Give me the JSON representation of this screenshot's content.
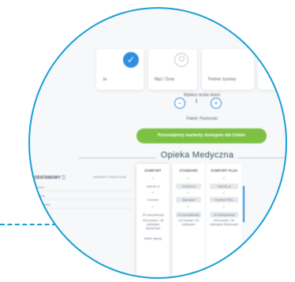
{
  "cards": {
    "self_label": "Ja",
    "wife_label": "Mąż / Żona",
    "partner_label": "Partner życiowy"
  },
  "children": {
    "question": "Wybierz liczbę dzieci",
    "count": "1",
    "minus_label": "−",
    "plus_label": "+"
  },
  "package_label": "Pakiet: Partnerski",
  "cta_label": "Pozostajemy warianty dostępne dla Ciebie",
  "section_title": "Opieka Medyczna",
  "table": {
    "left_title": "PODSTAWOWY",
    "left_info_icon": "info-icon",
    "left_subheader": "WARIANTY MEDYCZNE",
    "left_rows": [
      "Lekarze",
      "Badania",
      "Diagnostyka"
    ],
    "columns": [
      {
        "header": "KOMFORT",
        "price": "189,00 zł",
        "tier": "Komfort",
        "specialists": "25 specjalizacji",
        "details": "150 badań i 28 zabiegów fizjoterapii",
        "more": "Wiele więcej"
      },
      {
        "header": "STANDARD",
        "price": "149,00 zł",
        "tier": "Standard",
        "specialists": "20 specjalizacji",
        "details": "120 badań i 20 zabiegów",
        "more": ""
      },
      {
        "header": "KOMFORT PLUS",
        "price": "249,00 zł",
        "tier": "Komfort Plus",
        "specialists": "29 specjalizacji",
        "details": "200 badań i 30 zabiegów fizjoterapii",
        "more": ""
      }
    ]
  },
  "colors": {
    "accent": "#2f8ee0",
    "ring": "#1a9fd6",
    "cta": "#7dc142"
  }
}
